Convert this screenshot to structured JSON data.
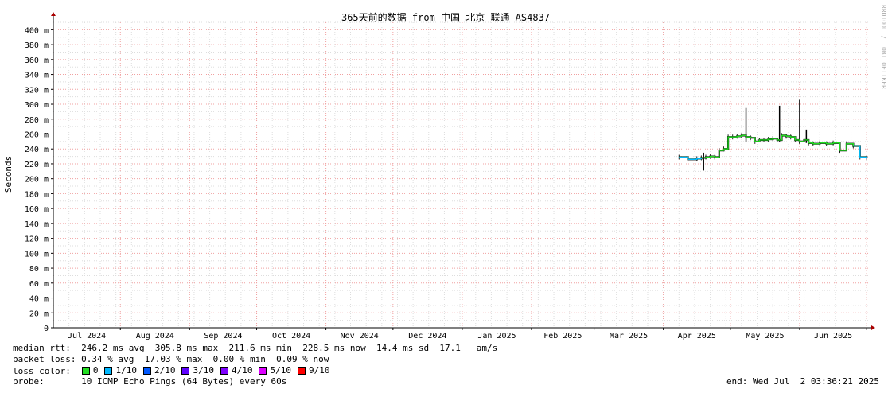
{
  "chart_data": {
    "type": "line",
    "title": "365天前的数据 from 中国 北京 联通 AS4837",
    "ylabel": "Seconds",
    "xlabel": "",
    "ylim": [
      0,
      410
    ],
    "y_unit_suffix": "m",
    "y_ticks": [
      0,
      20,
      40,
      60,
      80,
      100,
      120,
      140,
      160,
      180,
      200,
      220,
      240,
      260,
      280,
      300,
      320,
      340,
      360,
      380,
      400
    ],
    "x_tick_labels": [
      "Jul 2024",
      "Aug 2024",
      "Sep 2024",
      "Oct 2024",
      "Nov 2024",
      "Dec 2024",
      "Jan 2025",
      "Feb 2025",
      "Mar 2025",
      "Apr 2025",
      "May 2025",
      "Jun 2025"
    ],
    "x_range": [
      "2024-07-02",
      "2025-07-02"
    ],
    "grid": true,
    "series": [
      {
        "name": "median rtt",
        "x": [
          "2025-04-08",
          "2025-04-12",
          "2025-04-16",
          "2025-04-18",
          "2025-04-20",
          "2025-04-22",
          "2025-04-24",
          "2025-04-26",
          "2025-04-28",
          "2025-04-30",
          "2025-05-02",
          "2025-05-04",
          "2025-05-06",
          "2025-05-08",
          "2025-05-10",
          "2025-05-12",
          "2025-05-14",
          "2025-05-16",
          "2025-05-18",
          "2025-05-20",
          "2025-05-22",
          "2025-05-24",
          "2025-05-26",
          "2025-05-28",
          "2025-05-30",
          "2025-06-01",
          "2025-06-03",
          "2025-06-05",
          "2025-06-07",
          "2025-06-10",
          "2025-06-13",
          "2025-06-16",
          "2025-06-19",
          "2025-06-22",
          "2025-06-25",
          "2025-06-28",
          "2025-07-01"
        ],
        "values": [
          229,
          226,
          227,
          228,
          229,
          230,
          229,
          238,
          240,
          256,
          256,
          257,
          258,
          256,
          255,
          250,
          252,
          252,
          253,
          254,
          252,
          258,
          257,
          256,
          252,
          250,
          252,
          248,
          247,
          248,
          247,
          248,
          238,
          247,
          244,
          229,
          228
        ]
      }
    ],
    "spikes": [
      {
        "x": "2025-04-19",
        "max": 235,
        "min": 211
      },
      {
        "x": "2025-05-08",
        "max": 295,
        "min": 249
      },
      {
        "x": "2025-05-23",
        "max": 298,
        "min": 250
      },
      {
        "x": "2025-06-01",
        "max": 306,
        "min": 247
      },
      {
        "x": "2025-06-04",
        "max": 266,
        "min": 248
      }
    ],
    "loss_colors": [
      "#22dd22",
      "#00b8ff",
      "#0059ff",
      "#5e00ff",
      "#7e00ff",
      "#dd00ff",
      "#ff0000"
    ]
  },
  "stats": {
    "median_rtt": "median rtt:  246.2 ms avg  305.8 ms max  211.6 ms min  228.5 ms now  14.4 ms sd  17.1   am/s",
    "packet_loss": "packet loss: 0.34 % avg  17.03 % max  0.00 % min  0.09 % now",
    "loss_color_label": "loss color:",
    "probe": "probe:       10 ICMP Echo Pings (64 Bytes) every 60s",
    "end": "end: Wed Jul  2 03:36:21 2025"
  },
  "legend": [
    {
      "label": "0",
      "color": "#22dd22"
    },
    {
      "label": "1/10",
      "color": "#00b8ff"
    },
    {
      "label": "2/10",
      "color": "#0059ff"
    },
    {
      "label": "3/10",
      "color": "#5e00ff"
    },
    {
      "label": "4/10",
      "color": "#7e00ff"
    },
    {
      "label": "5/10",
      "color": "#dd00ff"
    },
    {
      "label": "9/10",
      "color": "#ff0000"
    }
  ],
  "watermark": "RRDTOOL / TOBI OETIKER"
}
